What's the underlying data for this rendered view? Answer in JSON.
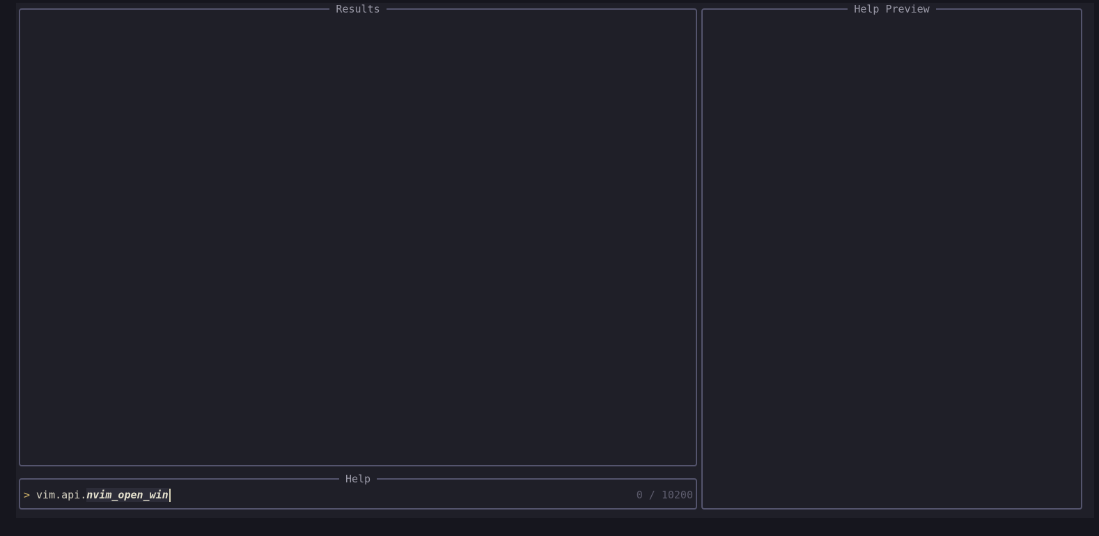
{
  "results": {
    "title": "Results"
  },
  "preview": {
    "title": "Help Preview"
  },
  "prompt": {
    "title": "Help",
    "prefix": ">",
    "query_plain": "vim.api.",
    "query_match": "nvim_open_win",
    "counter": "0 / 10200"
  },
  "colors": {
    "background": "#1f1f28",
    "border": "#54546d",
    "prefix": "#d7b96b",
    "counter": "#5e5d6e"
  }
}
